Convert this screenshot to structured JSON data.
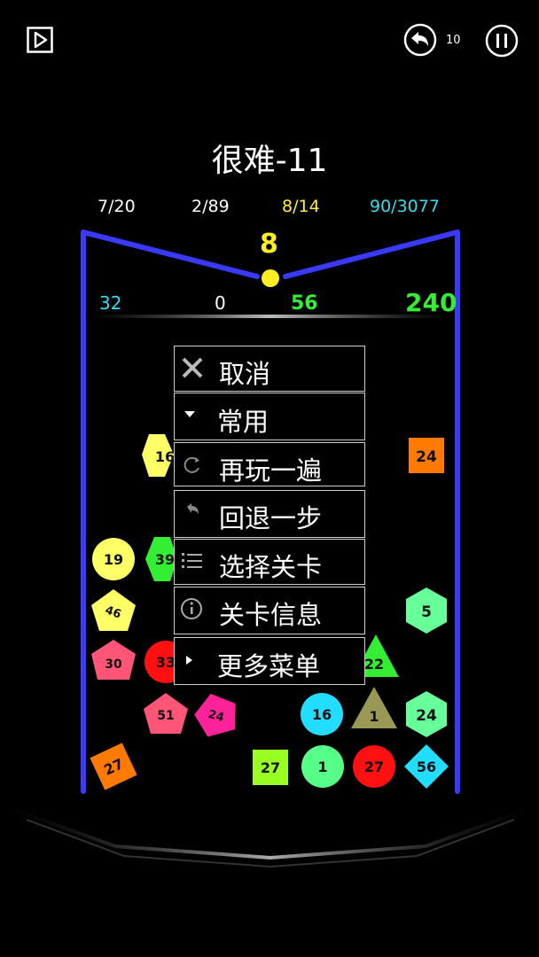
{
  "header": {
    "undo_count": "10"
  },
  "level_title": "很难-11",
  "stats": [
    "7/20",
    "2/89",
    "8/14",
    "90/3077"
  ],
  "ball_count": "8",
  "scores": {
    "left": "32",
    "mid": "0",
    "green": "56",
    "total": "240"
  },
  "menu": {
    "cancel": "取消",
    "common": "常用",
    "replay": "再玩一遍",
    "undo_step": "回退一步",
    "select_level": "选择关卡",
    "level_info": "关卡信息",
    "more_menu": "更多菜单"
  },
  "blocks": [
    {
      "shape": "hexagon",
      "value": "16",
      "color": "#ffff66"
    },
    {
      "shape": "square",
      "value": "24",
      "color": "#ff7a00"
    },
    {
      "shape": "circle",
      "value": "19",
      "color": "#ffff66"
    },
    {
      "shape": "hexagon",
      "value": "39",
      "color": "#33ee33"
    },
    {
      "shape": "pentagon",
      "value": "46",
      "color": "#ffff66"
    },
    {
      "shape": "hexagon",
      "value": "5",
      "color": "#66ff99"
    },
    {
      "shape": "pentagon",
      "value": "30",
      "color": "#ff5577"
    },
    {
      "shape": "circle",
      "value": "33",
      "color": "#ff1111"
    },
    {
      "shape": "triangle",
      "value": "22",
      "color": "#33ee33"
    },
    {
      "shape": "pentagon",
      "value": "51",
      "color": "#ff5577"
    },
    {
      "shape": "pentagon",
      "value": "24",
      "color": "#ff2299"
    },
    {
      "shape": "circle",
      "value": "16",
      "color": "#22ddff"
    },
    {
      "shape": "triangle",
      "value": "1",
      "color": "#999955"
    },
    {
      "shape": "hexagon",
      "value": "24",
      "color": "#66ff99"
    },
    {
      "shape": "square",
      "value": "27",
      "color": "#ff7a00"
    },
    {
      "shape": "square",
      "value": "27",
      "color": "#99ff22"
    },
    {
      "shape": "circle",
      "value": "1",
      "color": "#55ff88"
    },
    {
      "shape": "circle",
      "value": "27",
      "color": "#ff1111"
    },
    {
      "shape": "diamond",
      "value": "56",
      "color": "#22ddff"
    }
  ]
}
